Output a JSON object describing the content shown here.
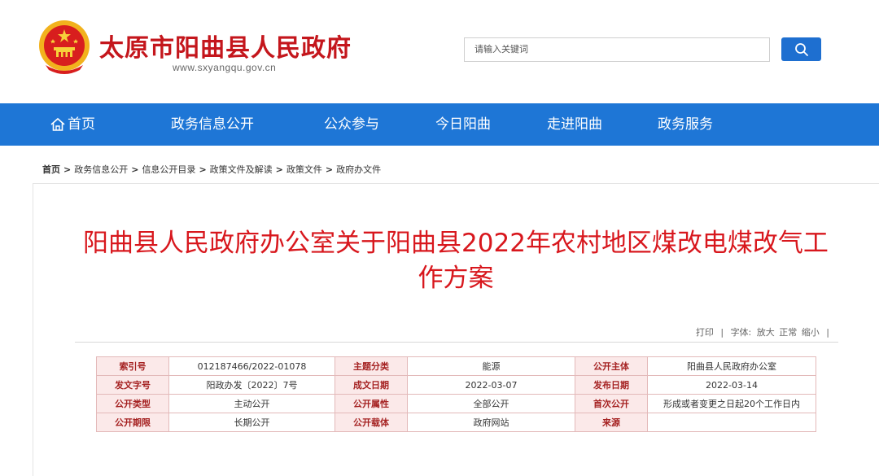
{
  "header": {
    "site_title": "太原市阳曲县人民政府",
    "site_url": "www.sxyangqu.gov.cn",
    "emblem_icon": "national-emblem-icon"
  },
  "search": {
    "placeholder": "请输入关键词",
    "button_icon": "search-icon"
  },
  "nav": {
    "items": [
      {
        "label": "首页",
        "icon": "home-icon"
      },
      {
        "label": "政务信息公开"
      },
      {
        "label": "公众参与"
      },
      {
        "label": "今日阳曲"
      },
      {
        "label": "走进阳曲"
      },
      {
        "label": "政务服务"
      }
    ]
  },
  "breadcrumb": [
    "首页",
    "政务信息公开",
    "信息公开目录",
    "政策文件及解读",
    "政策文件",
    "政府办文件"
  ],
  "breadcrumb_sep": ">",
  "article": {
    "title_line1": "阳曲县人民政府办公室关于阳曲县2022年农村地区煤改电煤改气工",
    "title_line2": "作方案"
  },
  "tools": {
    "print": "打印",
    "sep": "|",
    "font_label": "字体:",
    "large": "放大",
    "normal": "正常",
    "small": "缩小",
    "end_sep": "|"
  },
  "meta": {
    "rows": [
      [
        {
          "k": "索引号",
          "v": "012187466/2022-01078"
        },
        {
          "k": "主题分类",
          "v": "能源"
        },
        {
          "k": "公开主体",
          "v": "阳曲县人民政府办公室"
        }
      ],
      [
        {
          "k": "发文字号",
          "v": "阳政办发〔2022〕7号"
        },
        {
          "k": "成文日期",
          "v": "2022-03-07"
        },
        {
          "k": "发布日期",
          "v": "2022-03-14"
        }
      ],
      [
        {
          "k": "公开类型",
          "v": "主动公开"
        },
        {
          "k": "公开属性",
          "v": "全部公开"
        },
        {
          "k": "首次公开",
          "v": "形成或者变更之日起20个工作日内"
        }
      ],
      [
        {
          "k": "公开期限",
          "v": "长期公开"
        },
        {
          "k": "公开载体",
          "v": "政府网站"
        },
        {
          "k": "来源",
          "v": ""
        }
      ]
    ]
  },
  "colors": {
    "brand_red": "#c4161c",
    "nav_blue": "#1e76d6",
    "title_red": "#d8171d"
  }
}
